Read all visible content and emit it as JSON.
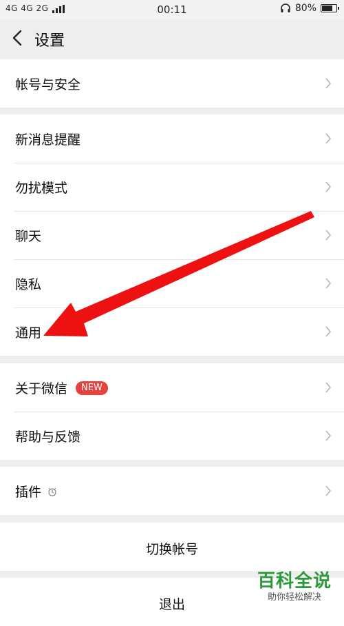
{
  "status_bar": {
    "network": "4G 4G 2G",
    "time": "00:11",
    "battery_percent": "80%",
    "battery_level": 0.8,
    "icons": [
      "signal-icon",
      "headphones-icon",
      "battery-icon"
    ]
  },
  "nav": {
    "back_icon": "chevron-left-icon",
    "title": "设置"
  },
  "groups": {
    "account": {
      "label": "帐号与安全"
    },
    "notifications": {
      "new_message": "新消息提醒",
      "do_not_disturb": "勿扰模式",
      "chat": "聊天",
      "privacy": "隐私",
      "general": "通用"
    },
    "about": {
      "about_wechat": "关于微信",
      "new_badge": "NEW",
      "help": "帮助与反馈"
    },
    "plugins": {
      "label": "插件",
      "icon": "plugin-icon"
    },
    "switch_account": {
      "label": "切换帐号"
    },
    "logout": {
      "label": "退出"
    }
  },
  "colors": {
    "accent_red": "#e64340",
    "arrow_red": "#ee1111",
    "watermark_green": "#2c9a3a"
  },
  "watermark": {
    "title": "百科全说",
    "subtitle": "助你轻松解决"
  }
}
